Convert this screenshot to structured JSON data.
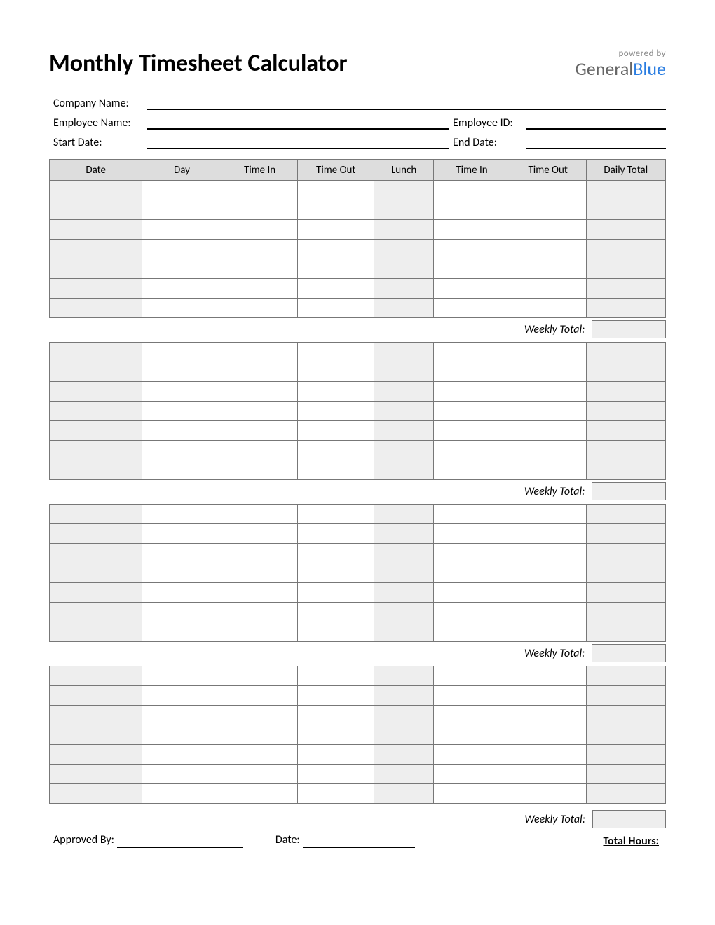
{
  "title": "Monthly Timesheet Calculator",
  "logo": {
    "powered": "powered by",
    "name_a": "General",
    "name_b": "Blue"
  },
  "meta": {
    "company_label": "Company Name:",
    "company_value": "",
    "employee_label": "Employee Name:",
    "employee_value": "",
    "employee_id_label": "Employee ID:",
    "employee_id_value": "",
    "start_date_label": "Start Date:",
    "start_date_value": "",
    "end_date_label": "End Date:",
    "end_date_value": ""
  },
  "columns": {
    "date": "Date",
    "day": "Day",
    "time_in": "Time In",
    "time_out": "Time Out",
    "lunch": "Lunch",
    "time_in2": "Time In",
    "time_out2": "Time Out",
    "daily_total": "Daily Total"
  },
  "weekly_total_label": "Weekly Total:",
  "footer": {
    "approved_by_label": "Approved By:",
    "date_label": "Date:",
    "total_hours_label": "Total Hours:"
  }
}
